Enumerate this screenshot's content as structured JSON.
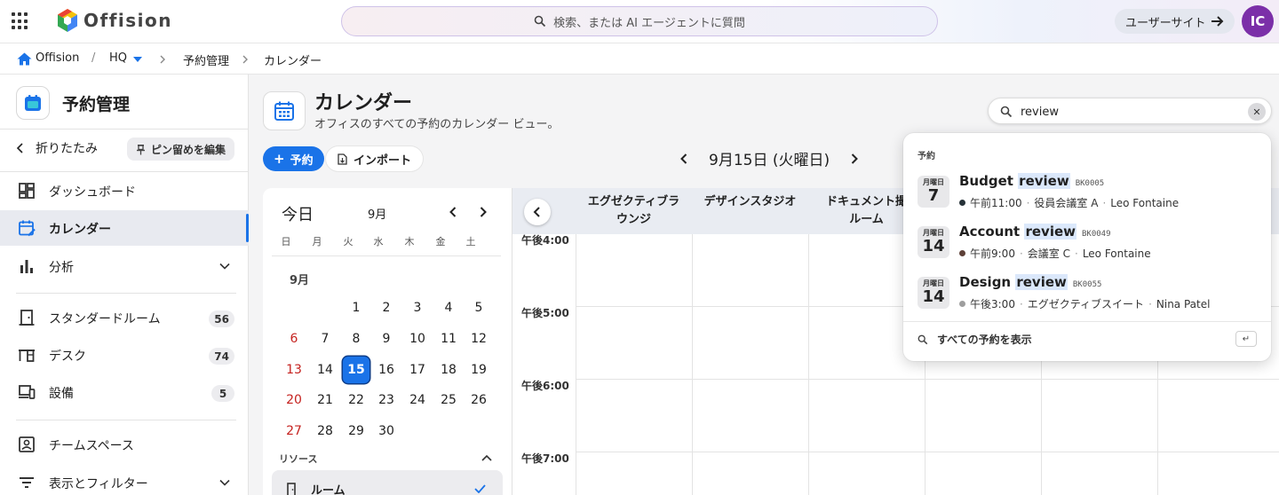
{
  "header": {
    "app_name": "Offision",
    "search_placeholder": "検索、または AI エージェントに質問",
    "user_site_label": "ユーザーサイト",
    "avatar_initials": "IC"
  },
  "breadcrumb": {
    "home": "Offision",
    "location": "HQ",
    "section": "予約管理",
    "page": "カレンダー"
  },
  "sidebar": {
    "title": "予約管理",
    "collapse_label": "折りたたみ",
    "pin_label": "ピン留めを編集",
    "items": [
      {
        "label": "ダッシュボード",
        "icon": "dashboard-icon"
      },
      {
        "label": "カレンダー",
        "icon": "calendar-icon",
        "active": true
      },
      {
        "label": "分析",
        "icon": "bar-chart-icon"
      },
      {
        "label": "スタンダードルーム",
        "icon": "door-icon",
        "count": "56"
      },
      {
        "label": "デスク",
        "icon": "desk-icon",
        "count": "74"
      },
      {
        "label": "設備",
        "icon": "devices-icon",
        "count": "5"
      },
      {
        "label": "チームスペース",
        "icon": "team-icon"
      },
      {
        "label": "表示とフィルター",
        "icon": "filter-icon"
      }
    ]
  },
  "main": {
    "title": "カレンダー",
    "subtitle": "オフィスのすべての予約のカレンダー ビュー。",
    "book_label": "予約",
    "import_label": "インポート",
    "current_date": "9月15日 (火曜日)"
  },
  "mini_calendar": {
    "today_label": "今日",
    "month": "9月",
    "weekdays": [
      "日",
      "月",
      "火",
      "水",
      "木",
      "金",
      "土"
    ],
    "month_label": "9月",
    "weeks": [
      [
        "",
        "",
        "1",
        "2",
        "3",
        "4",
        "5"
      ],
      [
        "6",
        "7",
        "8",
        "9",
        "10",
        "11",
        "12"
      ],
      [
        "13",
        "14",
        "15",
        "16",
        "17",
        "18",
        "19"
      ],
      [
        "20",
        "21",
        "22",
        "23",
        "24",
        "25",
        "26"
      ],
      [
        "27",
        "28",
        "29",
        "30",
        "",
        "",
        ""
      ]
    ],
    "selected_day": "15",
    "resources_label": "リソース",
    "resource_item": "ルーム"
  },
  "grid": {
    "columns": [
      [
        "エグゼクティブラ",
        "ウンジ"
      ],
      [
        "デザインスタジオ"
      ],
      [
        "ドキュメント撮",
        "ルーム"
      ]
    ],
    "time_labels": [
      "午後4:00",
      "午後5:00",
      "午後6:00",
      "午後7:00"
    ]
  },
  "search": {
    "query": "review",
    "section_label": "予約",
    "results": [
      {
        "weekday": "月曜日",
        "day": "7",
        "title": "Budget",
        "match": "review",
        "code": "BK0005",
        "time": "午前11:00",
        "room": "役員会議室 A",
        "person": "Leo Fontaine",
        "dot_color": "#263238"
      },
      {
        "weekday": "月曜日",
        "day": "14",
        "title": "Account",
        "match": "review",
        "code": "BK0049",
        "time": "午前9:00",
        "room": "会議室 C",
        "person": "Leo Fontaine",
        "dot_color": "#5d4037"
      },
      {
        "weekday": "月曜日",
        "day": "14",
        "title": "Design",
        "match": "review",
        "code": "BK0055",
        "time": "午後3:00",
        "room": "エグゼクティブスイート",
        "person": "Nina Patel",
        "dot_color": "#9e9e9e"
      }
    ],
    "show_all_label": "すべての予約を表示",
    "enter_key": "↵"
  },
  "colors": {
    "accent": "#1a73e8",
    "avatar": "#7b2fa8",
    "sunday": "#c5221f"
  }
}
